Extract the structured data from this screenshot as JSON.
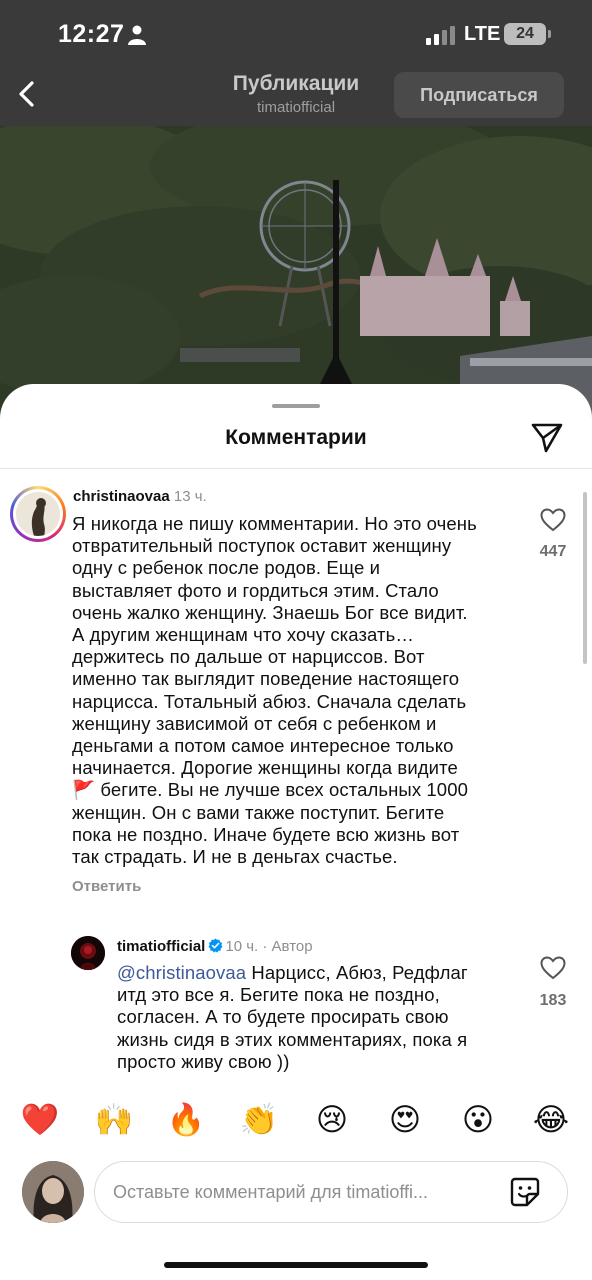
{
  "status_bar": {
    "time": "12:27",
    "network": "LTE",
    "battery": "24"
  },
  "header": {
    "title": "Публикации",
    "subtitle": "timatiofficial",
    "subscribe_label": "Подписаться"
  },
  "comments_sheet": {
    "title": "Комментарии"
  },
  "comments": [
    {
      "username": "christinaovaa",
      "time": "13 ч.",
      "text_lines": [
        "Я никогда не пишу комментарии. Но это очень",
        "отвратительный поступок оставит женщину",
        "одну с ребенок после родов. Еще и",
        "выставляет фото и гордиться этим. Стало",
        "очень жалко женщину. Знаешь Бог все видит.",
        "А другим женщинам что хочу сказать…",
        "держитесь по дальше от нарциссов. Вот",
        "именно так выглядит поведение настоящего",
        "нарцисса. Тотальный абюз. Сначала сделать",
        "женщину зависимой от себя с ребенком и",
        "деньгами а потом самое интересное только",
        "начинается. Дорогие женщины когда видите",
        "🚩 бегите. Вы не лучше всех остальных 1000",
        "женщин. Он с вами также поступит. Бегите",
        "пока не поздно. Иначе будете всю жизнь вот",
        "так страдать. И не в деньгах счастье."
      ],
      "likes": "447",
      "reply_label": "Ответить"
    },
    {
      "username": "timatiofficial",
      "verified": true,
      "time": "10 ч.",
      "author_label": "Автор",
      "mention": "@christinaovaa",
      "text_lines": [
        " Нарцисс, Абюз, Редфлаг",
        "итд это все я. Бегите пока не поздно,",
        "согласен. А то будете просирать свою",
        "жизнь сидя в этих комментариях, пока я",
        "просто живу свою ))"
      ],
      "likes": "183"
    }
  ],
  "emoji_bar": [
    "❤️",
    "🙌",
    "🔥",
    "👏",
    "😢",
    "😍",
    "😮",
    "😂"
  ],
  "composer": {
    "placeholder": "Оставьте комментарий для timatioffi..."
  },
  "colors": {
    "link": "#3d5a99",
    "verified": "#0095f6",
    "heart_red": "#ed4956"
  }
}
